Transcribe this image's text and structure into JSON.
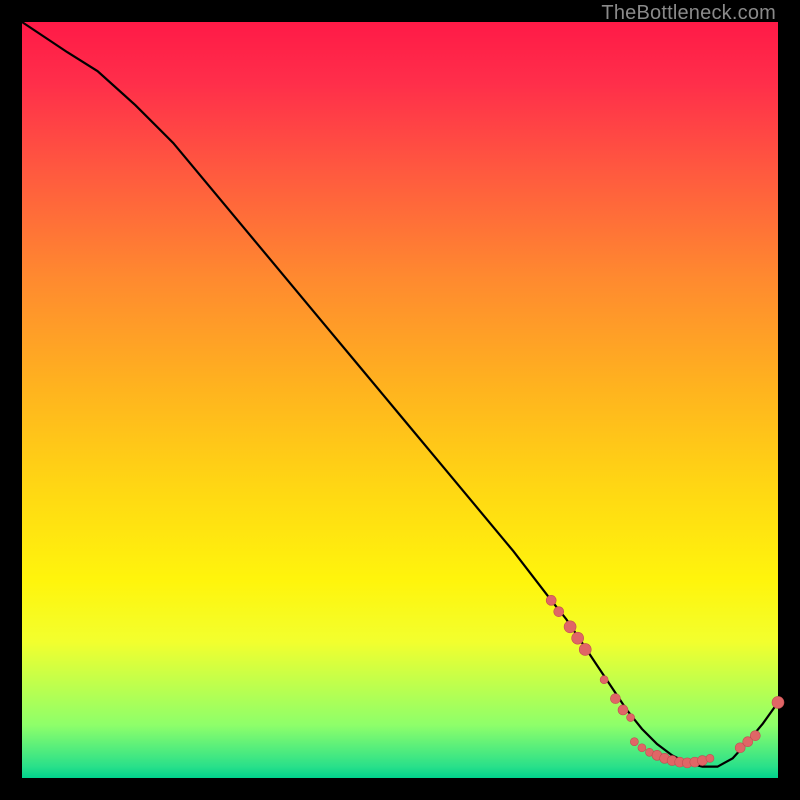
{
  "watermark": "TheBottleneck.com",
  "colors": {
    "frame": "#000000",
    "curve": "#000000",
    "marker_fill": "#e06666",
    "marker_stroke": "#c24d52"
  },
  "chart_data": {
    "type": "line",
    "title": "",
    "xlabel": "",
    "ylabel": "",
    "xlim": [
      0,
      100
    ],
    "ylim": [
      0,
      100
    ],
    "series": [
      {
        "name": "bottleneck-curve",
        "x": [
          0,
          3,
          6,
          10,
          15,
          20,
          25,
          30,
          35,
          40,
          45,
          50,
          55,
          60,
          65,
          70,
          72,
          74,
          76,
          78,
          80,
          82,
          84,
          86,
          88,
          90,
          92,
          94,
          96,
          98,
          100
        ],
        "y": [
          100,
          98,
          96,
          93.5,
          89,
          84,
          78,
          72,
          66,
          60,
          54,
          48,
          42,
          36,
          30,
          23.5,
          21,
          18,
          15,
          12,
          9,
          6.5,
          4.5,
          3,
          2,
          1.5,
          1.5,
          2.6,
          4.8,
          7.2,
          10
        ]
      }
    ],
    "markers": [
      {
        "x": 70.0,
        "y": 23.5,
        "r": 5
      },
      {
        "x": 71.0,
        "y": 22.0,
        "r": 5
      },
      {
        "x": 72.5,
        "y": 20.0,
        "r": 6
      },
      {
        "x": 73.5,
        "y": 18.5,
        "r": 6
      },
      {
        "x": 74.5,
        "y": 17.0,
        "r": 6
      },
      {
        "x": 77.0,
        "y": 13.0,
        "r": 4
      },
      {
        "x": 78.5,
        "y": 10.5,
        "r": 5
      },
      {
        "x": 79.5,
        "y": 9.0,
        "r": 5
      },
      {
        "x": 80.5,
        "y": 8.0,
        "r": 4
      },
      {
        "x": 81.0,
        "y": 4.8,
        "r": 4
      },
      {
        "x": 82.0,
        "y": 4.0,
        "r": 4
      },
      {
        "x": 83.0,
        "y": 3.4,
        "r": 4
      },
      {
        "x": 84.0,
        "y": 3.0,
        "r": 5
      },
      {
        "x": 85.0,
        "y": 2.6,
        "r": 5
      },
      {
        "x": 86.0,
        "y": 2.3,
        "r": 5
      },
      {
        "x": 87.0,
        "y": 2.1,
        "r": 5
      },
      {
        "x": 88.0,
        "y": 2.0,
        "r": 5
      },
      {
        "x": 89.0,
        "y": 2.1,
        "r": 5
      },
      {
        "x": 90.0,
        "y": 2.3,
        "r": 5
      },
      {
        "x": 91.0,
        "y": 2.6,
        "r": 4
      },
      {
        "x": 95.0,
        "y": 4.0,
        "r": 5
      },
      {
        "x": 96.0,
        "y": 4.8,
        "r": 5
      },
      {
        "x": 97.0,
        "y": 5.6,
        "r": 5
      },
      {
        "x": 100.0,
        "y": 10.0,
        "r": 6
      }
    ]
  }
}
